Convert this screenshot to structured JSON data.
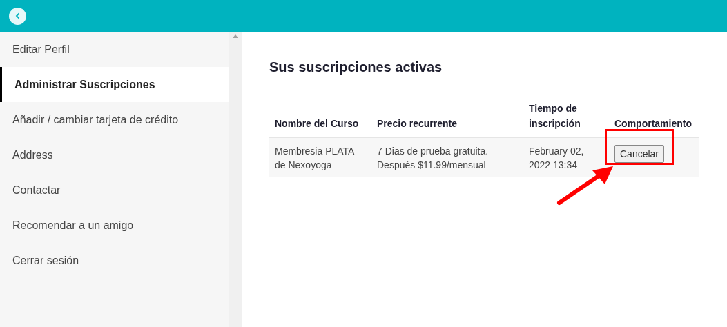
{
  "sidebar": {
    "items": [
      {
        "label": "Editar Perfil",
        "selected": false
      },
      {
        "label": "Administrar Suscripciones",
        "selected": true
      },
      {
        "label": "Añadir / cambiar tarjeta de crédito",
        "selected": false
      },
      {
        "label": "Address",
        "selected": false
      },
      {
        "label": "Contactar",
        "selected": false
      },
      {
        "label": "Recomendar a un amigo",
        "selected": false
      },
      {
        "label": "Cerrar sesión",
        "selected": false
      }
    ]
  },
  "main": {
    "title": "Sus suscripciones activas",
    "table": {
      "columns": [
        "Nombre del Curso",
        "Precio recurrente",
        "Tiempo de inscripción",
        "Comportamiento"
      ],
      "rows": [
        {
          "course": "Membresia PLATA de Nexoyoga",
          "price": "7 Dias de prueba gratuita. Después $11.99/mensual",
          "time": "February 02, 2022 13:34",
          "action": "Cancelar"
        }
      ]
    }
  }
}
